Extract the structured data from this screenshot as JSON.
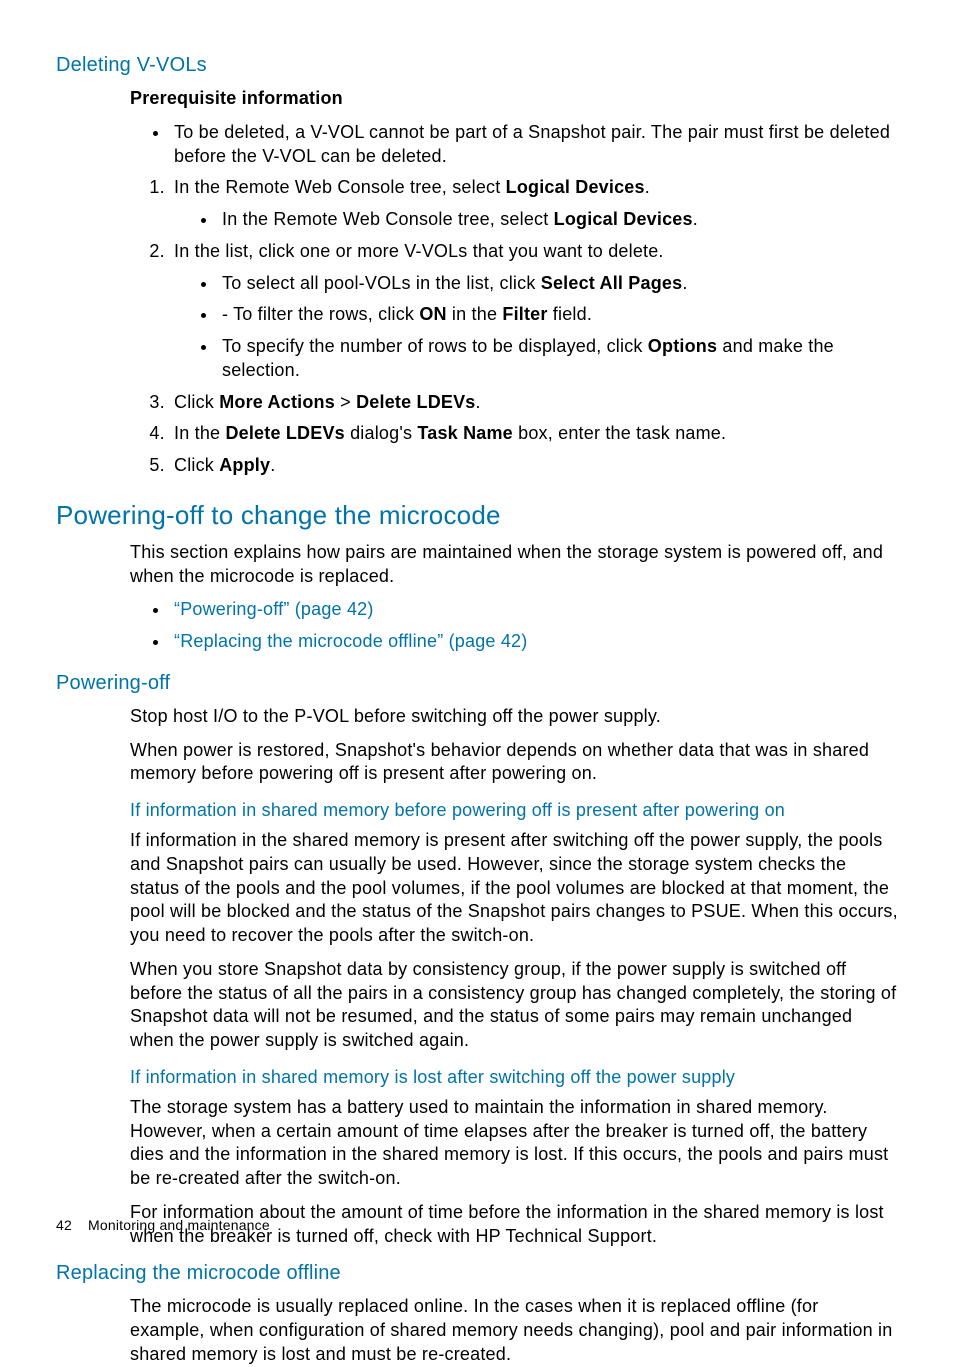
{
  "s1": {
    "h3": "Deleting V-VOLs",
    "prereq": "Prerequisite information",
    "bullet1a": "To be deleted, a V-VOL cannot be part of a Snapshot pair. The pair must first be deleted before the V-VOL can be deleted.",
    "step1_pre": "In the Remote Web Console tree, select ",
    "step1_b": "Logical Devices",
    "step1_post": ".",
    "step1_sub_pre": "In the Remote Web Console tree, select ",
    "step1_sub_b": "Logical Devices",
    "step1_sub_post": ".",
    "step2": "In the list, click one or more V-VOLs that you want to delete.",
    "step2_sub1_pre": "To select all pool-VOLs in the list, click ",
    "step2_sub1_b": "Select All Pages",
    "step2_sub1_post": ".",
    "step2_sub2_pre": "- To filter the rows, click ",
    "step2_sub2_b1": "ON",
    "step2_sub2_mid": " in the ",
    "step2_sub2_b2": "Filter",
    "step2_sub2_post": " field.",
    "step2_sub3_pre": "To specify the number of rows to be displayed, click ",
    "step2_sub3_b": "Options",
    "step2_sub3_post": " and make the selection.",
    "step3_pre": "Click ",
    "step3_b1": "More Actions",
    "step3_mid": " > ",
    "step3_b2": "Delete LDEVs",
    "step3_post": ".",
    "step4_pre": "In the ",
    "step4_b1": "Delete LDEVs",
    "step4_mid1": " dialog's ",
    "step4_b2": "Task Name",
    "step4_post": " box, enter the task name.",
    "step5_pre": "Click ",
    "step5_b": "Apply",
    "step5_post": "."
  },
  "s2": {
    "h2": "Powering-off to change the microcode",
    "intro": "This section explains how pairs are maintained when the storage system is powered off, and when the microcode is replaced.",
    "link1": "“Powering-off” (page 42)",
    "link2": "“Replacing the microcode offline” (page 42)"
  },
  "s3": {
    "h3": "Powering-off",
    "p1": "Stop host I/O to the P-VOL before switching off the power supply.",
    "p2": "When power is restored, Snapshot's behavior depends on whether data that was in shared memory before powering off is present after powering on.",
    "h4a": "If information in shared memory before powering off is present after powering on",
    "p3": "If information in the shared memory is present after switching off the power supply, the pools and Snapshot pairs can usually be used. However, since the storage system checks the status of the pools and the pool volumes, if the pool volumes are blocked at that moment, the pool will be blocked and the status of the Snapshot pairs changes to PSUE. When this occurs, you need to recover the pools after the switch-on.",
    "p4": "When you store Snapshot data by consistency group, if the power supply is switched off before the status of all the pairs in a consistency group has changed completely, the storing of Snapshot data will not be resumed, and the status of some pairs may remain unchanged when the power supply is switched again.",
    "h4b": "If information in shared memory is lost after switching off the power supply",
    "p5": "The storage system has a battery used to maintain the information in shared memory. However, when a certain amount of time elapses after the breaker is turned off, the battery dies and the information in the shared memory is lost. If this occurs, the pools and pairs must be re-created after the switch-on.",
    "p6": "For information about the amount of time before the information in the shared memory is lost when the breaker is turned off, check with HP Technical Support."
  },
  "s4": {
    "h3": "Replacing the microcode offline",
    "p1": "The microcode is usually replaced online. In the cases when it is replaced offline (for example, when configuration of shared memory needs changing), pool and pair information in shared memory is lost and must be re-created."
  },
  "footer": {
    "page": "42",
    "title": "Monitoring and maintenance"
  }
}
